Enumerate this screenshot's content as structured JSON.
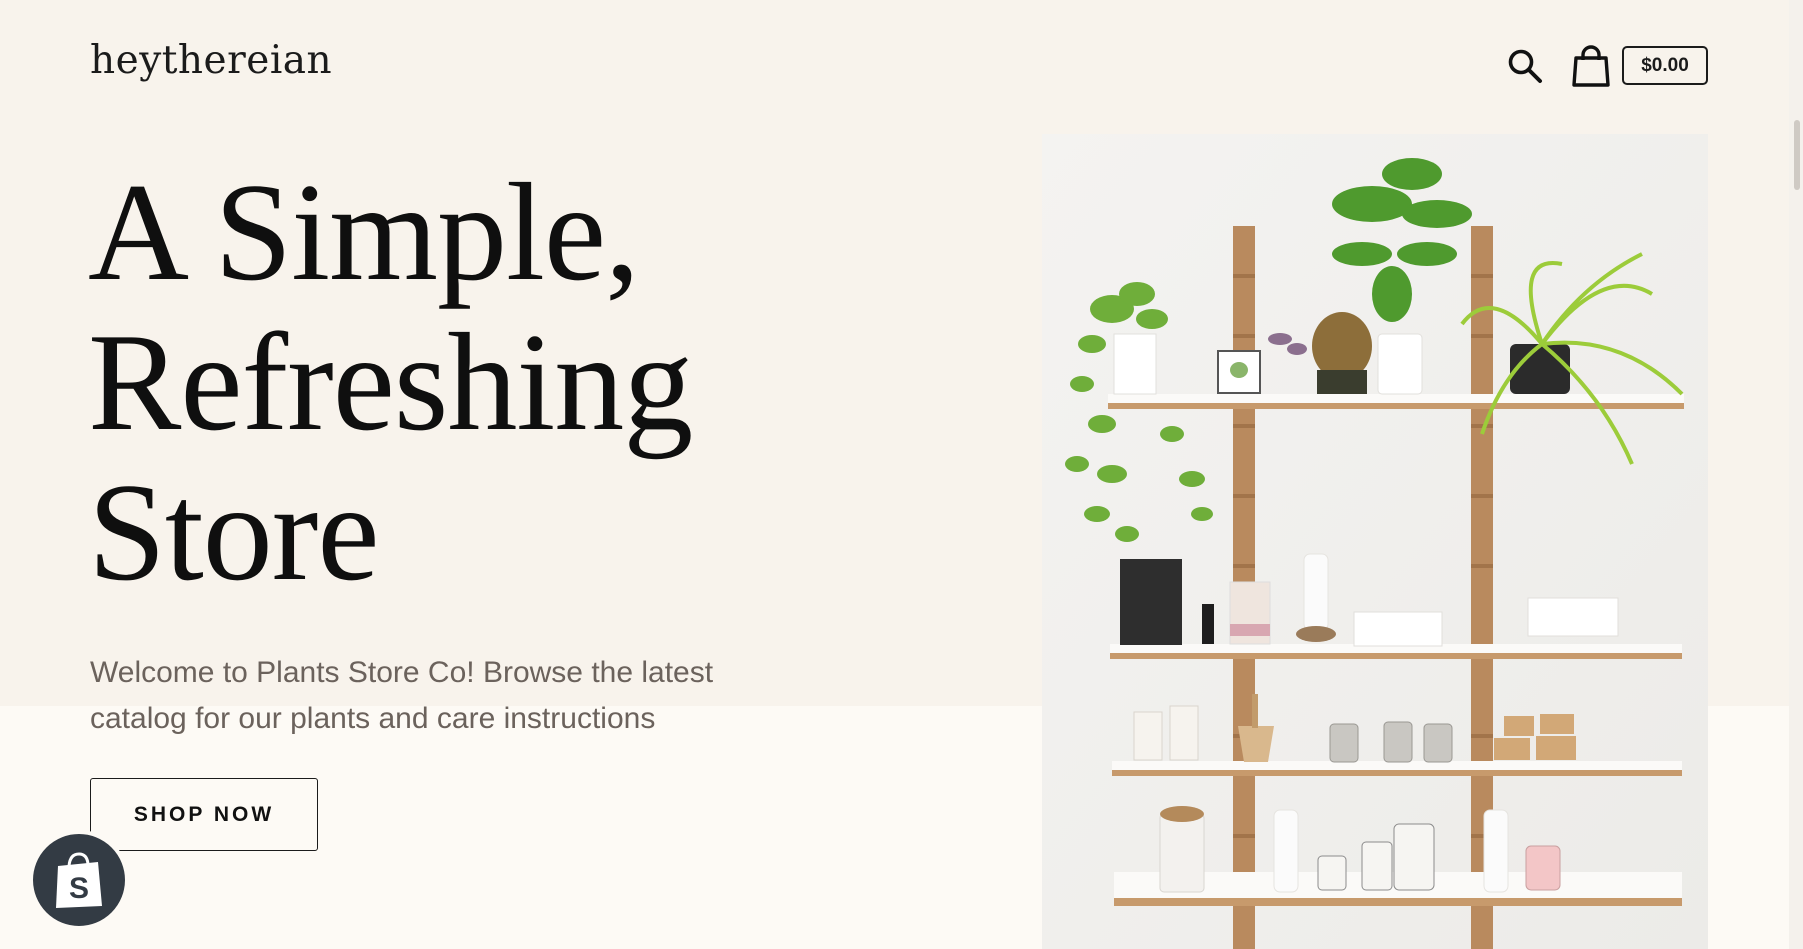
{
  "header": {
    "logo": "heythereian",
    "cart_total": "$0.00",
    "icons": {
      "search": "search-icon",
      "cart": "shopping-bag-icon"
    }
  },
  "hero": {
    "headline": [
      "A Simple,",
      "Refreshing",
      "Store"
    ],
    "intro": "Welcome to Plants Store Co! Browse the latest catalog for our plants and care instructions",
    "cta_label": "SHOP NOW",
    "image_subject": "plant-shelf-photo"
  },
  "badge": {
    "icon": "shopify-bag-icon",
    "label": "S"
  },
  "colors": {
    "hero_background": "#f8f3ec",
    "page_background": "#fdfaf5",
    "text_dark": "#0f0f0f",
    "text_muted": "#6b625c",
    "badge_background": "#333b44"
  }
}
